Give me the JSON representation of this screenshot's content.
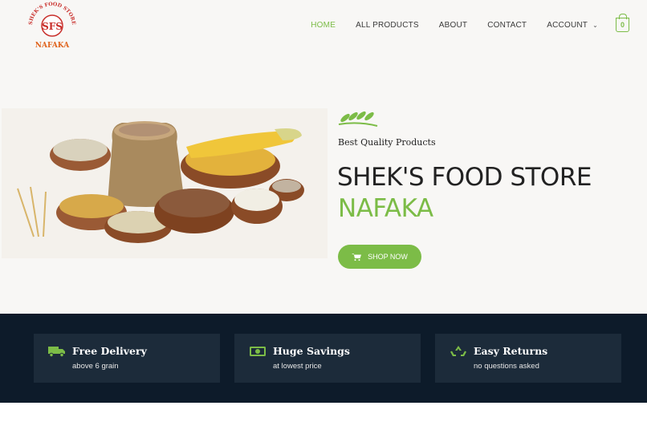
{
  "logo": {
    "arc_text": "SHEK'S FOOD STORE",
    "monogram": "SFS",
    "brand": "NAFAKA"
  },
  "nav": {
    "items": [
      {
        "label": "HOME",
        "active": true
      },
      {
        "label": "ALL PRODUCTS"
      },
      {
        "label": "ABOUT"
      },
      {
        "label": "CONTACT"
      },
      {
        "label": "ACCOUNT"
      }
    ],
    "cart_count": "0"
  },
  "hero": {
    "tagline": "Best Quality Products",
    "title_line1": "SHEK'S FOOD STORE",
    "title_line2": "NAFAKA",
    "button_label": "SHOP NOW"
  },
  "features": [
    {
      "title": "Free Delivery",
      "subtitle": "above 6 grain",
      "icon": "truck-icon"
    },
    {
      "title": "Huge Savings",
      "subtitle": "at lowest price",
      "icon": "money-icon"
    },
    {
      "title": "Easy Returns",
      "subtitle": "no questions asked",
      "icon": "recycle-icon"
    }
  ],
  "colors": {
    "accent": "#7cbc47",
    "band": "#0d1b2a",
    "card": "#1c2b3a",
    "hero_bg": "#f8f7f5"
  }
}
